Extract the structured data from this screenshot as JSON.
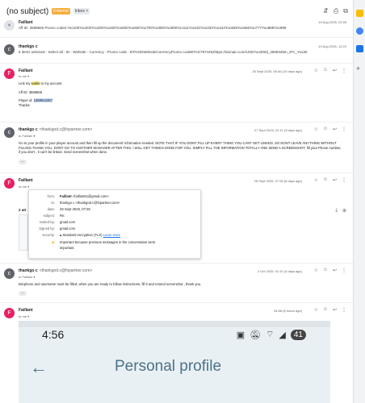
{
  "thread": {
    "subject": "(no subject)",
    "badge_external": "External",
    "badge_inbox": "Inbox ×"
  },
  "messages": [
    {
      "avatar": "",
      "sender": "Faillant",
      "date": "15 Aug 2025, 22:59",
      "preview": "Aff ID: 3589665 Promo codes:Yoo100Yoo200Yoo300Yoo400Yoo500Yoo600Yoo700Yoo800Yoo900Yoo111Yoo222Yoo333Yoo444Yoo555Yoo666Yoo777Yoo888Yoo999"
    },
    {
      "avatar": "",
      "sender": "thankgo c",
      "date": "19 Aug 2025, 12:22",
      "preview": "5 items selected - Select all - ID - Website - Currency - Promo code - BTAGIDWebsiteCurrencyPromo codeBTAG7974452https://domain.com/USDYoo300d_4605348m_97c_Yoo30"
    },
    {
      "avatar": "F",
      "sender": "Faillant",
      "to": "to me ▾",
      "date": "26 Sept 2025, 05:46 (10 days ago)",
      "body_pre": "Link my ",
      "body_hl": "wallet",
      "body_post": " to my account",
      "aff": "Aff ID: 3589665",
      "player_label": "Player id: ",
      "player_id": "1359612467",
      "thanks": "Thanks"
    },
    {
      "avatar": "",
      "sender": "thankgo c",
      "address": "<thankgod.c@fxpartner.com>",
      "to": "to Faillant ▾",
      "date": "27 Sept 2025, 22:11 (9 days ago)",
      "body": "Go to your profile in your player account and then fill up the  document' information needed. NOTE THAT IF YOU DONT FILL UP EVERY THING YOU CANT GET LINKED, SO DONT LEAVE ANYTHING WITHOUT FILLING.THANK YOU.  DONT GO TO ANOTHER MANAGER AFTER THIS. I WILL GET THINGS DONE FOR YOU. SIMPLY FILL THE INFORMATION TOTALLY AND SEND A SCREENSHOT, fill your Phone number, if you don't , it can't be linked. Send screenshot when done."
    },
    {
      "avatar": "F",
      "sender": "Faillant",
      "to": "to me ▾",
      "date": "28 Sept 2025, 07:28 (8 days ago)",
      "attachments_label": "2 att"
    },
    {
      "avatar": "",
      "sender": "thankgo c",
      "address": "<thankgod.c@fxpartner.com>",
      "to": "to Faillant ▾",
      "date": "2 Oct 2025, 01:10 (4 days ago)",
      "body": "telephone and username must be filled, when you are ready to follow instructions, fill it and resend screenshot , thank you."
    },
    {
      "avatar": "F",
      "sender": "Faillant",
      "to": "to me ▾",
      "date": "04:58 (6 hours ago)"
    }
  ],
  "details_popup": {
    "from_label": "from:",
    "from_name": "Faillant",
    "from_addr": "<faillant61@gmail.com>",
    "to_label": "to:",
    "to_value": "thankgo c <thankgod.c@fxpartner.com>",
    "date_label": "date:",
    "date_value": "28 Sept 2025, 07:28",
    "subject_label": "subject:",
    "subject_value": "Re:",
    "mailedby_label": "mailed-by:",
    "mailedby_value": "gmail.com",
    "signedby_label": "Signed by:",
    "signedby_value": "gmail.com",
    "security_label": "security:",
    "security_value": "Standard encryption (TLS)",
    "learn_more": "Learn more",
    "important_line1": "Important because previous messages in the conversation were",
    "important_line2": "important."
  },
  "phone_screenshot": {
    "time": "4:56",
    "battery": "41",
    "title": "Personal profile"
  },
  "colors": {
    "avatar_pink": "#e91e63",
    "avatar_gray": "#5f6368",
    "external_badge": "#f6ac3e",
    "profile_teal": "#4b7288"
  }
}
